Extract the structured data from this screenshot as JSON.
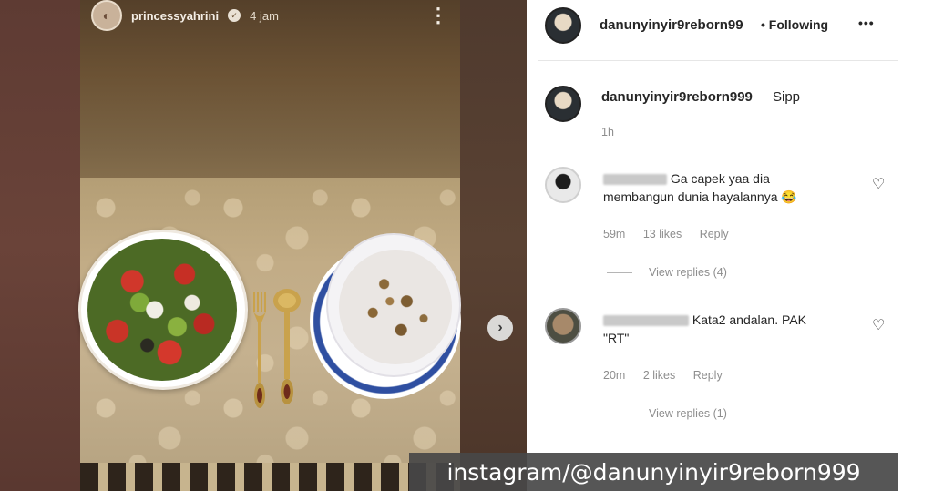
{
  "story": {
    "username": "princessyahrini",
    "time": "4 jam",
    "more": "⋮",
    "next": "›"
  },
  "post": {
    "author": "danunyinyir9reborn99",
    "following": "• Following",
    "more": "•••"
  },
  "caption": {
    "author": "danunyinyir9reborn999",
    "text": "Sipp",
    "time": "1h"
  },
  "comments": [
    {
      "text_line1": "Ga capek yaa dia",
      "text_line2": "membangun dunia hayalannya 😂",
      "time": "59m",
      "likes": "13 likes",
      "reply": "Reply",
      "view_replies": "View replies (4)"
    },
    {
      "text_line1": "Kata2 andalan. PAK",
      "text_line2": "\"RT\"",
      "time": "20m",
      "likes": "2 likes",
      "reply": "Reply",
      "view_replies": "View replies (1)"
    }
  ],
  "watermark": "instagram/@danunyinyir9reborn999",
  "icons": {
    "heart": "♡",
    "verified": "✓"
  }
}
